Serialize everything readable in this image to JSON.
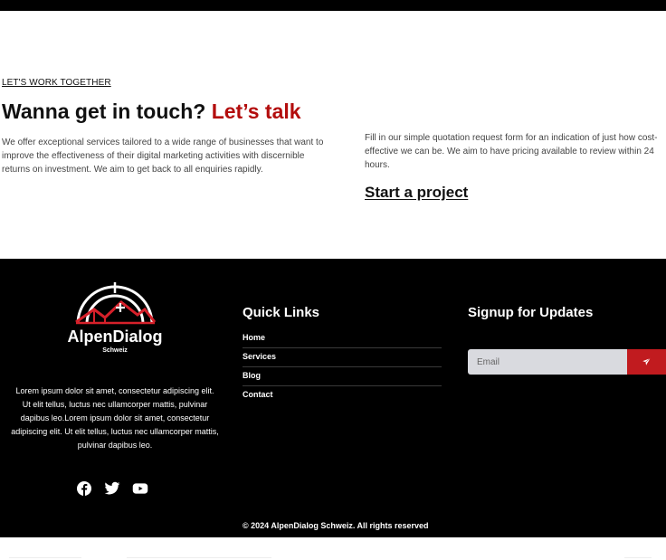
{
  "contact": {
    "eyebrow": "LET'S WORK TOGETHER",
    "headline_main": "Wanna get in touch?",
    "headline_accent": "Let’s talk",
    "intro": "We offer exceptional services tailored to a wide range of businesses that want to improve the effectiveness of their digital marketing activities with discernible returns on investment. We aim to get back to all enquiries rapidly.",
    "quote_text": "Fill in our simple quotation request form for an indication of just how cost-effective we can be. We aim to have pricing available to review within 24 hours.",
    "cta": "Start a project"
  },
  "footer": {
    "brand": {
      "name": "AlpenDialog",
      "sub": "Schweiz"
    },
    "about": "Lorem ipsum dolor sit amet, consectetur adipiscing elit. Ut elit tellus, luctus nec ullamcorper mattis, pulvinar dapibus leo.Lorem ipsum dolor sit amet, consectetur adipiscing elit. Ut elit tellus, luctus nec ullamcorper mattis, pulvinar dapibus leo.",
    "socials": [
      "facebook-icon",
      "twitter-icon",
      "youtube-icon"
    ],
    "quick_links": {
      "title": "Quick Links",
      "items": [
        "Home",
        "Services",
        "Blog",
        "Contact"
      ]
    },
    "signup": {
      "title": "Signup for Updates",
      "placeholder": "Email",
      "button_icon": "send-icon"
    },
    "copyright": "© 2024 AlpenDialog Schweiz. All rights reserved"
  },
  "colors": {
    "accent": "#b30d0d",
    "button": "#c11b1f",
    "footer_bg": "#000000",
    "input_bg": "#d9dadf"
  }
}
